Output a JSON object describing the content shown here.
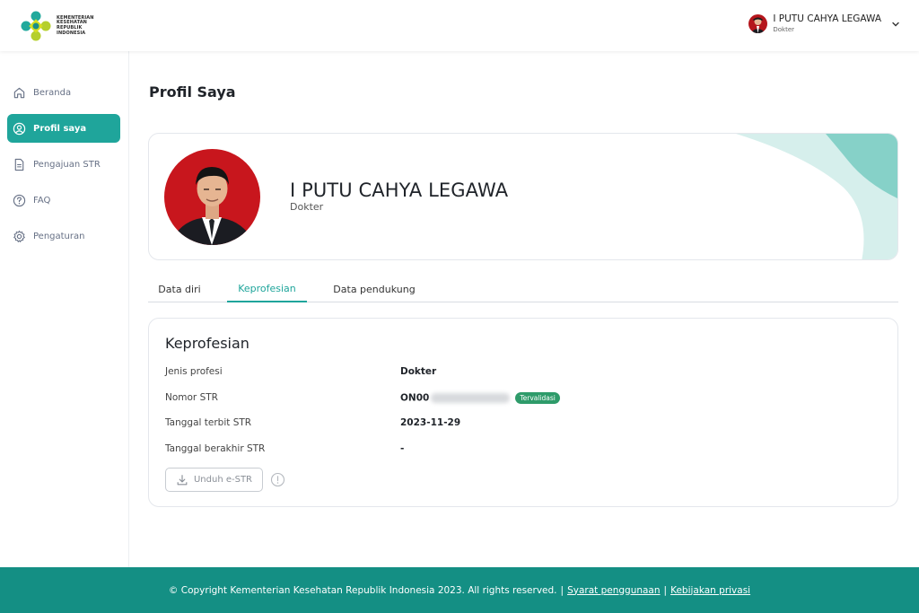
{
  "brand": {
    "logo_lines": [
      "KEMENTERIAN",
      "KESEHATAN",
      "REPUBLIK",
      "INDONESIA"
    ],
    "accent": "#1fa59b"
  },
  "header": {
    "user_name": "I PUTU CAHYA LEGAWA",
    "user_role": "Dokter"
  },
  "sidebar": {
    "items": [
      {
        "label": "Beranda",
        "icon": "home-icon",
        "active": false
      },
      {
        "label": "Profil saya",
        "icon": "user-circle-icon",
        "active": true
      },
      {
        "label": "Pengajuan STR",
        "icon": "document-icon",
        "active": false
      },
      {
        "label": "FAQ",
        "icon": "question-icon",
        "active": false
      },
      {
        "label": "Pengaturan",
        "icon": "gear-icon",
        "active": false
      }
    ]
  },
  "main": {
    "page_title": "Profil Saya",
    "profile": {
      "name": "I PUTU CAHYA LEGAWA",
      "role": "Dokter"
    },
    "tabs": [
      {
        "label": "Data diri",
        "active": false
      },
      {
        "label": "Keprofesian",
        "active": true
      },
      {
        "label": "Data pendukung",
        "active": false
      }
    ],
    "section": {
      "title": "Keprofesian",
      "rows": [
        {
          "label": "Jenis profesi",
          "value": "Dokter"
        },
        {
          "label": "Nomor STR",
          "value": "ON00",
          "badge": "Tervalidasi"
        },
        {
          "label": "Tanggal terbit STR",
          "value": "2023-11-29"
        },
        {
          "label": "Tanggal berakhir STR",
          "value": "-"
        }
      ],
      "download_label": "Unduh e-STR"
    }
  },
  "footer": {
    "copyright": "© Copyright Kementerian Kesehatan Republik Indonesia 2023. All rights reserved.",
    "sep": "|",
    "terms": "Syarat penggunaan",
    "privacy": "Kebijakan privasi"
  }
}
